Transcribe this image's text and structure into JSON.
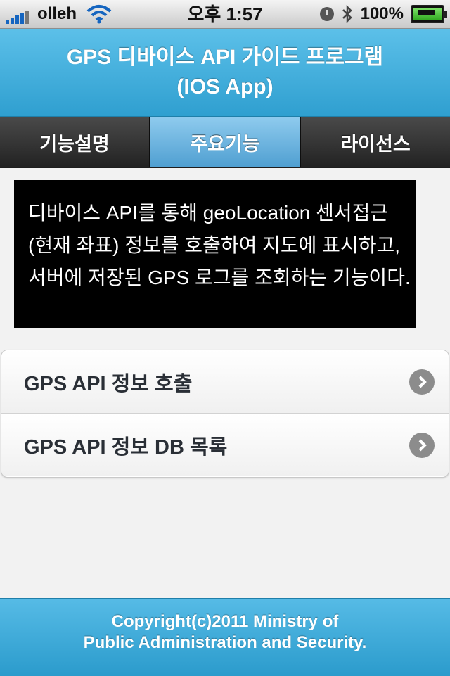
{
  "status_bar": {
    "carrier": "olleh",
    "time": "오후 1:57",
    "battery": "100%",
    "icons": [
      "signal-icon",
      "wifi-icon",
      "clock-icon",
      "bluetooth-icon",
      "battery-charging-icon"
    ]
  },
  "header": {
    "title_line1": "GPS 디바이스 API 가이드 프로그램",
    "title_line2": "(IOS App)"
  },
  "tabs": [
    {
      "label": "기능설명",
      "active": false
    },
    {
      "label": "주요기능",
      "active": true
    },
    {
      "label": "라이선스",
      "active": false
    }
  ],
  "description": "디바이스 API를 통해 geoLocation 센서접근(현재 좌표) 정보를 호출하여 지도에 표시하고, 서버에 저장된 GPS 로그를 조회하는 기능이다.",
  "list": [
    {
      "label": "GPS API 정보 호출"
    },
    {
      "label": "GPS API 정보 DB 목록"
    }
  ],
  "footer": {
    "line1": "Copyright(c)2011 Ministry of",
    "line2": "Public Administration and Security."
  },
  "colors": {
    "header_blue": "#3aa8d8",
    "tab_active": "#6fb6e2",
    "tab_dark": "#2f2f2f",
    "description_bg": "#000000"
  }
}
